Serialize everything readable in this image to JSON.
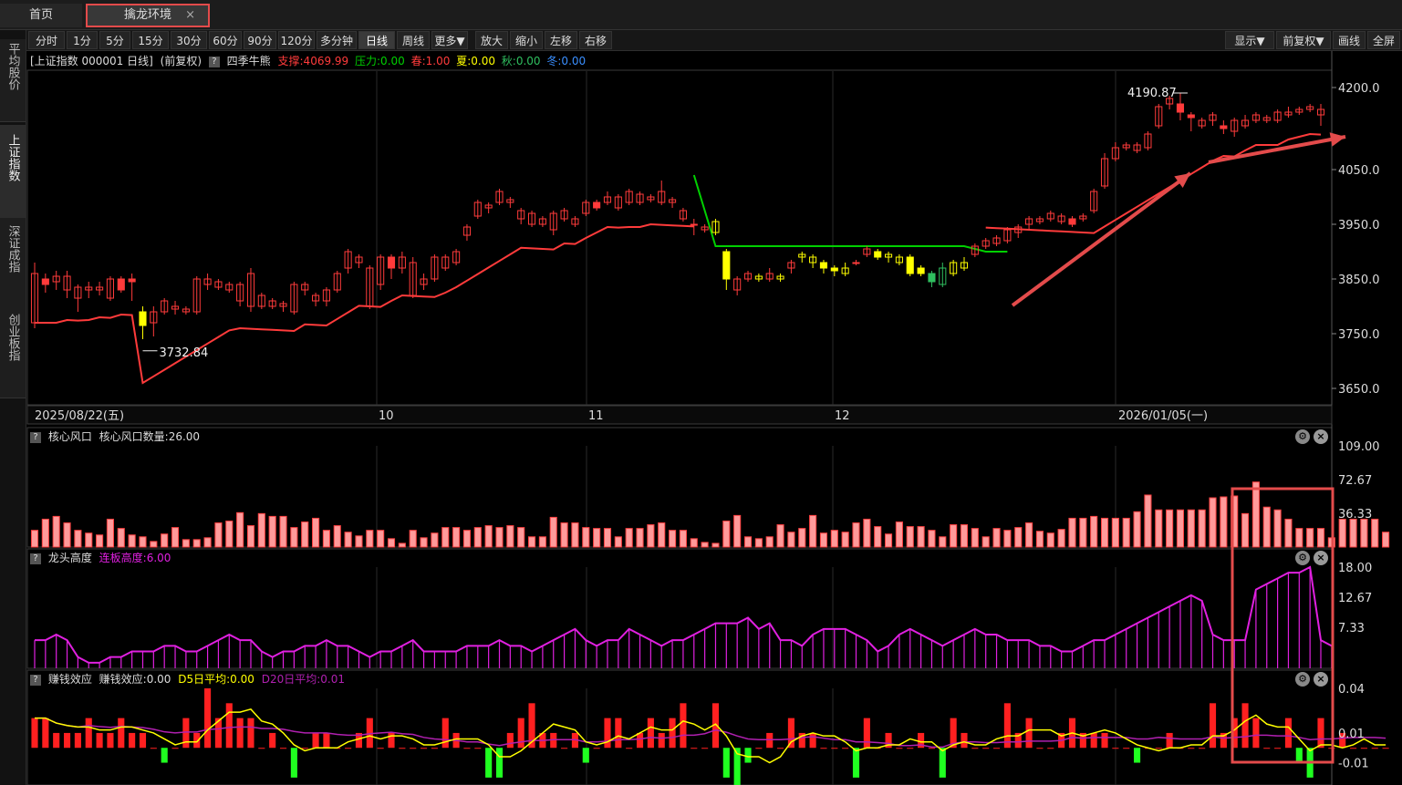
{
  "tabs": {
    "home": "首页",
    "active": "擒龙环境",
    "close": "×"
  },
  "leftnav": [
    "平均股价",
    "上证指数",
    "深证成指",
    "创业板指"
  ],
  "toolbar": {
    "periods": [
      "分时",
      "1分",
      "5分",
      "15分",
      "30分",
      "60分",
      "90分",
      "120分",
      "多分钟",
      "日线",
      "周线",
      "更多▼",
      "放大",
      "缩小",
      "左移",
      "右移"
    ],
    "selected_period": "日线",
    "right": [
      "显示▼",
      "前复权▼",
      "画线",
      "全屏"
    ]
  },
  "main_info": {
    "title": "[上证指数 000001 日线]",
    "adj": "(前复权)",
    "indicator": "四季牛熊",
    "support": "支撑:4069.99",
    "pressure": "压力:0.00",
    "spring": "春:1.00",
    "summer": "夏:0.00",
    "autumn": "秋:0.00",
    "winter": "冬:0.00"
  },
  "colors": {
    "up": "#ff3b3b",
    "down": "#ffff00",
    "green": "#00d000",
    "magenta": "#e020e0",
    "annotation": "#e34b4b"
  },
  "main_axis": {
    "labels": [
      "4200.0",
      "4050.0",
      "3950.0",
      "3850.0",
      "3750.0",
      "3650.0"
    ]
  },
  "annotations": {
    "high": "4190.87",
    "low": "3732.84"
  },
  "date_axis": [
    "2025/08/22(五)",
    "10",
    "11",
    "12",
    "2026/01/05(一)"
  ],
  "panel1": {
    "name": "核心风口",
    "label": "核心风口数量:26.00",
    "axis": [
      "109.00",
      "72.67",
      "36.33"
    ]
  },
  "panel2": {
    "name": "龙头高度",
    "label": "连板高度:6.00",
    "axis": [
      "18.00",
      "12.67",
      "7.33"
    ]
  },
  "panel3": {
    "name": "赚钱效应",
    "label": "赚钱效应:0.00",
    "d5": "D5日平均:0.00",
    "d20": "D20日平均:0.01",
    "axis": [
      "0.04",
      "0.01",
      "-0.01"
    ]
  },
  "chart_data": {
    "type": "candlestick",
    "title": "上证指数 000001 日线",
    "ylim": [
      3620,
      4230
    ],
    "candles": [
      [
        3770,
        3860,
        3760,
        3880,
        "r"
      ],
      [
        3850,
        3840,
        3825,
        3860,
        "r"
      ],
      [
        3845,
        3855,
        3830,
        3865,
        "r"
      ],
      [
        3830,
        3855,
        3815,
        3865,
        "r"
      ],
      [
        3815,
        3835,
        3790,
        3840,
        "r"
      ],
      [
        3830,
        3835,
        3815,
        3845,
        "r"
      ],
      [
        3830,
        3835,
        3820,
        3845,
        "r"
      ],
      [
        3815,
        3850,
        3810,
        3855,
        "r"
      ],
      [
        3850,
        3830,
        3825,
        3855,
        "r"
      ],
      [
        3850,
        3845,
        3810,
        3860,
        "r"
      ],
      [
        3790,
        3765,
        3740,
        3800,
        "y"
      ],
      [
        3770,
        3790,
        3745,
        3800,
        "r"
      ],
      [
        3790,
        3810,
        3785,
        3815,
        "r"
      ],
      [
        3795,
        3800,
        3785,
        3810,
        "r"
      ],
      [
        3790,
        3795,
        3785,
        3800,
        "r"
      ],
      [
        3790,
        3850,
        3785,
        3855,
        "r"
      ],
      [
        3840,
        3850,
        3830,
        3860,
        "r"
      ],
      [
        3835,
        3845,
        3830,
        3850,
        "r"
      ],
      [
        3830,
        3840,
        3825,
        3845,
        "r"
      ],
      [
        3810,
        3840,
        3800,
        3845,
        "r"
      ],
      [
        3800,
        3860,
        3790,
        3870,
        "r"
      ],
      [
        3800,
        3820,
        3795,
        3825,
        "r"
      ],
      [
        3800,
        3810,
        3795,
        3815,
        "r"
      ],
      [
        3800,
        3805,
        3790,
        3810,
        "r"
      ],
      [
        3790,
        3840,
        3785,
        3845,
        "r"
      ],
      [
        3830,
        3840,
        3820,
        3845,
        "r"
      ],
      [
        3810,
        3820,
        3800,
        3825,
        "r"
      ],
      [
        3810,
        3830,
        3800,
        3835,
        "r"
      ],
      [
        3830,
        3860,
        3825,
        3865,
        "r"
      ],
      [
        3870,
        3900,
        3860,
        3905,
        "r"
      ],
      [
        3880,
        3890,
        3870,
        3895,
        "r"
      ],
      [
        3800,
        3870,
        3795,
        3875,
        "r"
      ],
      [
        3840,
        3890,
        3830,
        3895,
        "r"
      ],
      [
        3890,
        3870,
        3850,
        3895,
        "r"
      ],
      [
        3870,
        3890,
        3860,
        3900,
        "r"
      ],
      [
        3820,
        3880,
        3815,
        3890,
        "r"
      ],
      [
        3840,
        3850,
        3830,
        3860,
        "r"
      ],
      [
        3850,
        3890,
        3845,
        3895,
        "r"
      ],
      [
        3870,
        3890,
        3865,
        3895,
        "r"
      ],
      [
        3880,
        3900,
        3875,
        3905,
        "r"
      ],
      [
        3930,
        3945,
        3920,
        3950,
        "r"
      ],
      [
        3965,
        3990,
        3960,
        3995,
        "r"
      ],
      [
        3980,
        3985,
        3970,
        3990,
        "r"
      ],
      [
        3990,
        4010,
        3985,
        4015,
        "r"
      ],
      [
        3990,
        3995,
        3980,
        4000,
        "r"
      ],
      [
        3960,
        3975,
        3950,
        3980,
        "r"
      ],
      [
        3950,
        3970,
        3945,
        3975,
        "r"
      ],
      [
        3950,
        3960,
        3945,
        3965,
        "r"
      ],
      [
        3940,
        3970,
        3930,
        3975,
        "r"
      ],
      [
        3960,
        3975,
        3955,
        3980,
        "r"
      ],
      [
        3950,
        3960,
        3945,
        3965,
        "r"
      ],
      [
        3970,
        3990,
        3965,
        3995,
        "r"
      ],
      [
        3990,
        3980,
        3975,
        3995,
        "r"
      ],
      [
        3990,
        4000,
        3985,
        4010,
        "r"
      ],
      [
        3980,
        4000,
        3975,
        4005,
        "r"
      ],
      [
        3990,
        4010,
        3985,
        4015,
        "r"
      ],
      [
        3990,
        4005,
        3985,
        4010,
        "r"
      ],
      [
        3995,
        4000,
        3990,
        4005,
        "r"
      ],
      [
        3990,
        4010,
        3985,
        4030,
        "r"
      ],
      [
        3990,
        3995,
        3980,
        4000,
        "r"
      ],
      [
        3960,
        3975,
        3955,
        3980,
        "r"
      ],
      [
        3950,
        3950,
        3930,
        3960,
        "r"
      ],
      [
        3940,
        3945,
        3935,
        3950,
        "r"
      ],
      [
        3935,
        3955,
        3930,
        3960,
        "y"
      ],
      [
        3900,
        3850,
        3830,
        3905,
        "y"
      ],
      [
        3830,
        3850,
        3820,
        3855,
        "r"
      ],
      [
        3850,
        3860,
        3845,
        3865,
        "r"
      ],
      [
        3850,
        3855,
        3845,
        3860,
        "y"
      ],
      [
        3850,
        3860,
        3845,
        3870,
        "r"
      ],
      [
        3850,
        3855,
        3845,
        3860,
        "y"
      ],
      [
        3870,
        3880,
        3860,
        3885,
        "r"
      ],
      [
        3890,
        3895,
        3880,
        3900,
        "y"
      ],
      [
        3880,
        3890,
        3870,
        3895,
        "y"
      ],
      [
        3880,
        3870,
        3860,
        3885,
        "y"
      ],
      [
        3870,
        3865,
        3855,
        3875,
        "y"
      ],
      [
        3860,
        3870,
        3855,
        3880,
        "y"
      ],
      [
        3880,
        3880,
        3875,
        3885,
        "r"
      ],
      [
        3895,
        3905,
        3890,
        3910,
        "r"
      ],
      [
        3900,
        3890,
        3885,
        3905,
        "y"
      ],
      [
        3890,
        3895,
        3880,
        3900,
        "y"
      ],
      [
        3880,
        3890,
        3875,
        3895,
        "y"
      ],
      [
        3890,
        3860,
        3855,
        3895,
        "y"
      ],
      [
        3870,
        3860,
        3855,
        3875,
        "y"
      ],
      [
        3860,
        3845,
        3835,
        3865,
        "g"
      ],
      [
        3840,
        3870,
        3835,
        3880,
        "g"
      ],
      [
        3860,
        3880,
        3855,
        3885,
        "y"
      ],
      [
        3870,
        3880,
        3865,
        3890,
        "y"
      ],
      [
        3895,
        3910,
        3890,
        3915,
        "r"
      ],
      [
        3910,
        3920,
        3905,
        3925,
        "r"
      ],
      [
        3915,
        3925,
        3910,
        3930,
        "r"
      ],
      [
        3920,
        3940,
        3915,
        3945,
        "r"
      ],
      [
        3935,
        3945,
        3925,
        3950,
        "r"
      ],
      [
        3950,
        3960,
        3940,
        3965,
        "r"
      ],
      [
        3955,
        3960,
        3950,
        3965,
        "r"
      ],
      [
        3960,
        3970,
        3955,
        3975,
        "r"
      ],
      [
        3955,
        3965,
        3950,
        3970,
        "r"
      ],
      [
        3960,
        3950,
        3945,
        3965,
        "r"
      ],
      [
        3960,
        3965,
        3955,
        3970,
        "r"
      ],
      [
        3975,
        4010,
        3970,
        4015,
        "r"
      ],
      [
        4020,
        4070,
        4015,
        4080,
        "r"
      ],
      [
        4070,
        4090,
        4065,
        4100,
        "r"
      ],
      [
        4090,
        4095,
        4085,
        4100,
        "r"
      ],
      [
        4085,
        4095,
        4080,
        4100,
        "r"
      ],
      [
        4090,
        4115,
        4085,
        4120,
        "r"
      ],
      [
        4130,
        4165,
        4125,
        4170,
        "r"
      ],
      [
        4170,
        4180,
        4160,
        4185,
        "r"
      ],
      [
        4170,
        4155,
        4140,
        4190,
        "r"
      ],
      [
        4150,
        4145,
        4120,
        4155,
        "r"
      ],
      [
        4130,
        4140,
        4125,
        4145,
        "r"
      ],
      [
        4140,
        4150,
        4130,
        4155,
        "r"
      ],
      [
        4130,
        4125,
        4115,
        4140,
        "r"
      ],
      [
        4120,
        4140,
        4110,
        4145,
        "r"
      ],
      [
        4130,
        4140,
        4125,
        4150,
        "r"
      ],
      [
        4140,
        4150,
        4135,
        4155,
        "r"
      ],
      [
        4140,
        4145,
        4135,
        4150,
        "r"
      ],
      [
        4140,
        4155,
        4135,
        4160,
        "r"
      ],
      [
        4150,
        4155,
        4145,
        4165,
        "r"
      ],
      [
        4155,
        4160,
        4150,
        4165,
        "r"
      ],
      [
        4160,
        4165,
        4155,
        4170,
        "r"
      ],
      [
        4150,
        4160,
        4130,
        4170,
        "r"
      ]
    ],
    "p1_values": [
      18,
      30,
      33,
      26,
      18,
      15,
      13,
      30,
      20,
      13,
      11,
      6,
      14,
      21,
      8,
      8,
      10,
      26,
      28,
      37,
      23,
      36,
      33,
      33,
      21,
      27,
      31,
      18,
      23,
      16,
      12,
      18,
      18,
      9,
      4,
      18,
      10,
      15,
      21,
      21,
      18,
      21,
      23,
      21,
      23,
      21,
      11,
      11,
      32,
      26,
      26,
      21,
      20,
      20,
      11,
      20,
      20,
      24,
      26,
      18,
      18,
      9,
      5,
      4,
      28,
      34,
      11,
      9,
      11,
      24,
      16,
      20,
      34,
      15,
      18,
      16,
      26,
      30,
      22,
      14,
      27,
      22,
      22,
      18,
      11,
      24,
      24,
      20,
      11,
      20,
      18,
      21,
      26,
      17,
      15,
      19,
      31,
      31,
      33,
      31,
      31,
      31,
      38,
      56,
      40,
      40,
      40,
      40,
      40,
      53,
      54,
      55,
      36,
      70,
      43,
      40,
      30,
      20,
      20,
      20,
      10,
      30,
      30,
      30,
      30,
      16
    ],
    "p2_values": [
      5,
      5,
      6,
      5,
      2,
      1,
      1,
      2,
      2,
      3,
      3,
      3,
      4,
      4,
      3,
      3,
      4,
      5,
      6,
      5,
      5,
      3,
      2,
      3,
      3,
      4,
      4,
      5,
      4,
      4,
      3,
      2,
      3,
      3,
      4,
      5,
      3,
      3,
      3,
      3,
      4,
      4,
      4,
      5,
      4,
      4,
      3,
      4,
      5,
      6,
      7,
      5,
      4,
      5,
      5,
      7,
      6,
      5,
      4,
      5,
      5,
      6,
      7,
      8,
      8,
      8,
      9,
      7,
      8,
      5,
      5,
      4,
      6,
      7,
      7,
      7,
      6,
      5,
      3,
      4,
      6,
      7,
      6,
      5,
      4,
      5,
      6,
      7,
      6,
      6,
      5,
      5,
      5,
      4,
      4,
      3,
      3,
      4,
      5,
      5,
      6,
      7,
      8,
      9,
      10,
      11,
      12,
      13,
      12,
      6,
      5,
      5,
      5,
      14,
      15,
      16,
      17,
      17,
      18,
      5,
      4
    ],
    "p3_values": [
      0.02,
      0.02,
      0.01,
      0.01,
      0.01,
      0.02,
      0.01,
      0.01,
      0.02,
      0.01,
      0.01,
      0.0,
      -0.01,
      0.0,
      0.02,
      0.01,
      0.04,
      0.02,
      0.03,
      0.02,
      0.02,
      0.0,
      0.01,
      0.0,
      -0.02,
      0.0,
      0.01,
      0.01,
      0.0,
      0.0,
      0.01,
      0.02,
      0.0,
      0.01,
      0.0,
      0.0,
      0.0,
      0.0,
      0.02,
      0.01,
      0.0,
      0.0,
      -0.02,
      -0.02,
      0.01,
      0.02,
      0.03,
      0.01,
      0.01,
      0.0,
      0.01,
      -0.01,
      0.0,
      0.02,
      0.02,
      0.0,
      0.01,
      0.02,
      0.01,
      0.02,
      0.03,
      0.0,
      0.0,
      0.03,
      -0.02,
      -0.03,
      -0.01,
      0.0,
      0.01,
      0.0,
      0.02,
      0.01,
      0.01,
      0.0,
      0.0,
      0.0,
      -0.02,
      0.02,
      0.0,
      0.01,
      0.0,
      0.0,
      0.01,
      0.0,
      -0.02,
      0.02,
      0.01,
      0.0,
      0.0,
      0.0,
      0.03,
      0.01,
      0.02,
      0.0,
      0.0,
      0.01,
      0.02,
      0.01,
      0.01,
      0.01,
      0.0,
      0.0,
      -0.01,
      0.0,
      0.0,
      0.01,
      0.0,
      0.0,
      0.0,
      0.03,
      0.01,
      0.02,
      0.03,
      0.02,
      0.0,
      0.0,
      0.02,
      -0.01,
      -0.02,
      0.02,
      0.0,
      0.01,
      0.0,
      0.0,
      0.0,
      0.0
    ],
    "p1_ylim": [
      0,
      109
    ],
    "p2_ylim": [
      0,
      18
    ],
    "p3_ylim": [
      -0.025,
      0.04
    ]
  }
}
